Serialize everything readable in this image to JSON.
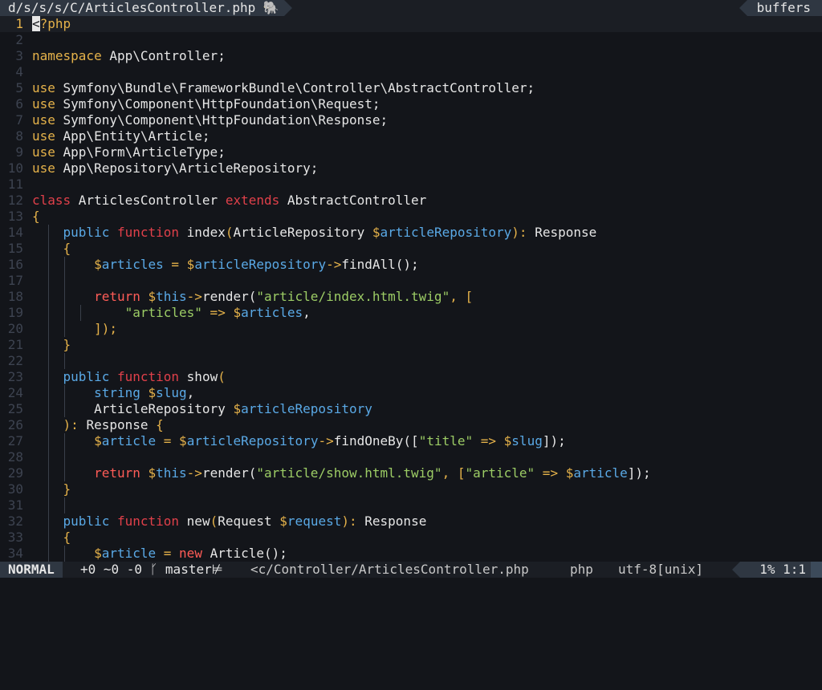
{
  "tabline": {
    "active_tab": "d/s/s/s/C/ArticlesController.php",
    "active_tab_icon": "🐘",
    "buffers_label": "buffers"
  },
  "editor": {
    "lines": [
      {
        "n": "1",
        "code": [
          {
            "t": "<",
            "c": "cursor"
          },
          {
            "t": "?php",
            "c": "tag"
          }
        ]
      },
      {
        "n": "2",
        "code": []
      },
      {
        "n": "3",
        "code": [
          {
            "t": "namespace ",
            "c": "ns"
          },
          {
            "t": "App\\Controller;",
            "c": "plain"
          }
        ]
      },
      {
        "n": "4",
        "code": []
      },
      {
        "n": "5",
        "code": [
          {
            "t": "use ",
            "c": "ns"
          },
          {
            "t": "Symfony\\Bundle\\FrameworkBundle\\Controller\\AbstractController;",
            "c": "plain"
          }
        ]
      },
      {
        "n": "6",
        "code": [
          {
            "t": "use ",
            "c": "ns"
          },
          {
            "t": "Symfony\\Component\\HttpFoundation\\Request;",
            "c": "plain"
          }
        ]
      },
      {
        "n": "7",
        "code": [
          {
            "t": "use ",
            "c": "ns"
          },
          {
            "t": "Symfony\\Component\\HttpFoundation\\Response;",
            "c": "plain"
          }
        ]
      },
      {
        "n": "8",
        "code": [
          {
            "t": "use ",
            "c": "ns"
          },
          {
            "t": "App\\Entity\\Article;",
            "c": "plain"
          }
        ]
      },
      {
        "n": "9",
        "code": [
          {
            "t": "use ",
            "c": "ns"
          },
          {
            "t": "App\\Form\\ArticleType;",
            "c": "plain"
          }
        ]
      },
      {
        "n": "10",
        "code": [
          {
            "t": "use ",
            "c": "ns"
          },
          {
            "t": "App\\Repository\\ArticleRepository;",
            "c": "plain"
          }
        ]
      },
      {
        "n": "11",
        "code": []
      },
      {
        "n": "12",
        "code": [
          {
            "t": "class ",
            "c": "kw"
          },
          {
            "t": "ArticlesController ",
            "c": "plain"
          },
          {
            "t": "extends ",
            "c": "kw"
          },
          {
            "t": "AbstractController",
            "c": "plain"
          }
        ]
      },
      {
        "n": "13",
        "code": [
          {
            "t": "{",
            "c": "punc"
          }
        ]
      },
      {
        "n": "14",
        "code": [
          {
            "t": "    "
          },
          {
            "t": "public ",
            "c": "fn-kw"
          },
          {
            "t": "function ",
            "c": "kw"
          },
          {
            "t": "index",
            "c": "plain"
          },
          {
            "t": "(",
            "c": "punc"
          },
          {
            "t": "ArticleRepository ",
            "c": "plain"
          },
          {
            "t": "$",
            "c": "var"
          },
          {
            "t": "articleRepository",
            "c": "varname"
          },
          {
            "t": "): ",
            "c": "punc"
          },
          {
            "t": "Response",
            "c": "plain"
          }
        ]
      },
      {
        "n": "15",
        "code": [
          {
            "t": "    "
          },
          {
            "t": "{",
            "c": "punc"
          }
        ]
      },
      {
        "n": "16",
        "code": [
          {
            "t": "        "
          },
          {
            "t": "$",
            "c": "var"
          },
          {
            "t": "articles",
            "c": "varname"
          },
          {
            "t": " = ",
            "c": "punc"
          },
          {
            "t": "$",
            "c": "var"
          },
          {
            "t": "articleRepository",
            "c": "varname"
          },
          {
            "t": "->",
            "c": "punc"
          },
          {
            "t": "findAll",
            "c": "plain"
          },
          {
            "t": "();",
            "c": "plain"
          }
        ]
      },
      {
        "n": "17",
        "code": []
      },
      {
        "n": "18",
        "code": [
          {
            "t": "        "
          },
          {
            "t": "return ",
            "c": "kw2"
          },
          {
            "t": "$",
            "c": "var"
          },
          {
            "t": "this",
            "c": "varname"
          },
          {
            "t": "->",
            "c": "punc"
          },
          {
            "t": "render(",
            "c": "plain"
          },
          {
            "t": "\"article/index.html.twig\"",
            "c": "str"
          },
          {
            "t": ", [",
            "c": "punc"
          }
        ]
      },
      {
        "n": "19",
        "code": [
          {
            "t": "            "
          },
          {
            "t": "\"articles\"",
            "c": "str"
          },
          {
            "t": " => ",
            "c": "punc"
          },
          {
            "t": "$",
            "c": "var"
          },
          {
            "t": "articles",
            "c": "varname"
          },
          {
            "t": ",",
            "c": "plain"
          }
        ]
      },
      {
        "n": "20",
        "code": [
          {
            "t": "        "
          },
          {
            "t": "]);",
            "c": "punc"
          }
        ]
      },
      {
        "n": "21",
        "code": [
          {
            "t": "    "
          },
          {
            "t": "}",
            "c": "punc"
          }
        ]
      },
      {
        "n": "22",
        "code": []
      },
      {
        "n": "23",
        "code": [
          {
            "t": "    "
          },
          {
            "t": "public ",
            "c": "fn-kw"
          },
          {
            "t": "function ",
            "c": "kw"
          },
          {
            "t": "show",
            "c": "plain"
          },
          {
            "t": "(",
            "c": "punc"
          }
        ]
      },
      {
        "n": "24",
        "code": [
          {
            "t": "        "
          },
          {
            "t": "string ",
            "c": "fn-kw"
          },
          {
            "t": "$",
            "c": "var"
          },
          {
            "t": "slug",
            "c": "varname"
          },
          {
            "t": ",",
            "c": "plain"
          }
        ]
      },
      {
        "n": "25",
        "code": [
          {
            "t": "        "
          },
          {
            "t": "ArticleRepository ",
            "c": "plain"
          },
          {
            "t": "$",
            "c": "var"
          },
          {
            "t": "articleRepository",
            "c": "varname"
          }
        ]
      },
      {
        "n": "26",
        "code": [
          {
            "t": "    "
          },
          {
            "t": "): ",
            "c": "punc"
          },
          {
            "t": "Response ",
            "c": "plain"
          },
          {
            "t": "{",
            "c": "punc"
          }
        ]
      },
      {
        "n": "27",
        "code": [
          {
            "t": "        "
          },
          {
            "t": "$",
            "c": "var"
          },
          {
            "t": "article",
            "c": "varname"
          },
          {
            "t": " = ",
            "c": "punc"
          },
          {
            "t": "$",
            "c": "var"
          },
          {
            "t": "articleRepository",
            "c": "varname"
          },
          {
            "t": "->",
            "c": "punc"
          },
          {
            "t": "findOneBy([",
            "c": "plain"
          },
          {
            "t": "\"title\"",
            "c": "str"
          },
          {
            "t": " => ",
            "c": "punc"
          },
          {
            "t": "$",
            "c": "var"
          },
          {
            "t": "slug",
            "c": "varname"
          },
          {
            "t": "]);",
            "c": "plain"
          }
        ]
      },
      {
        "n": "28",
        "code": []
      },
      {
        "n": "29",
        "code": [
          {
            "t": "        "
          },
          {
            "t": "return ",
            "c": "kw2"
          },
          {
            "t": "$",
            "c": "var"
          },
          {
            "t": "this",
            "c": "varname"
          },
          {
            "t": "->",
            "c": "punc"
          },
          {
            "t": "render(",
            "c": "plain"
          },
          {
            "t": "\"article/show.html.twig\"",
            "c": "str"
          },
          {
            "t": ", [",
            "c": "punc"
          },
          {
            "t": "\"article\"",
            "c": "str"
          },
          {
            "t": " => ",
            "c": "punc"
          },
          {
            "t": "$",
            "c": "var"
          },
          {
            "t": "article",
            "c": "varname"
          },
          {
            "t": "]);",
            "c": "plain"
          }
        ]
      },
      {
        "n": "30",
        "code": [
          {
            "t": "    "
          },
          {
            "t": "}",
            "c": "punc"
          }
        ]
      },
      {
        "n": "31",
        "code": []
      },
      {
        "n": "32",
        "code": [
          {
            "t": "    "
          },
          {
            "t": "public ",
            "c": "fn-kw"
          },
          {
            "t": "function ",
            "c": "kw"
          },
          {
            "t": "new",
            "c": "plain"
          },
          {
            "t": "(",
            "c": "punc"
          },
          {
            "t": "Request ",
            "c": "plain"
          },
          {
            "t": "$",
            "c": "var"
          },
          {
            "t": "request",
            "c": "varname"
          },
          {
            "t": "): ",
            "c": "punc"
          },
          {
            "t": "Response",
            "c": "plain"
          }
        ]
      },
      {
        "n": "33",
        "code": [
          {
            "t": "    "
          },
          {
            "t": "{",
            "c": "punc"
          }
        ]
      },
      {
        "n": "34",
        "code": [
          {
            "t": "        "
          },
          {
            "t": "$",
            "c": "var"
          },
          {
            "t": "article",
            "c": "varname"
          },
          {
            "t": " = ",
            "c": "punc"
          },
          {
            "t": "new ",
            "c": "kw2"
          },
          {
            "t": "Article",
            "c": "plain"
          },
          {
            "t": "();",
            "c": "plain"
          }
        ]
      }
    ]
  },
  "statusline": {
    "mode": "NORMAL",
    "git": "+0 ~0 -0 ᚴ master⊭",
    "file": "<c/Controller/ArticlesController.php",
    "filetype": "php",
    "encoding": "utf-8[unix]",
    "position": "1% 1:1"
  }
}
